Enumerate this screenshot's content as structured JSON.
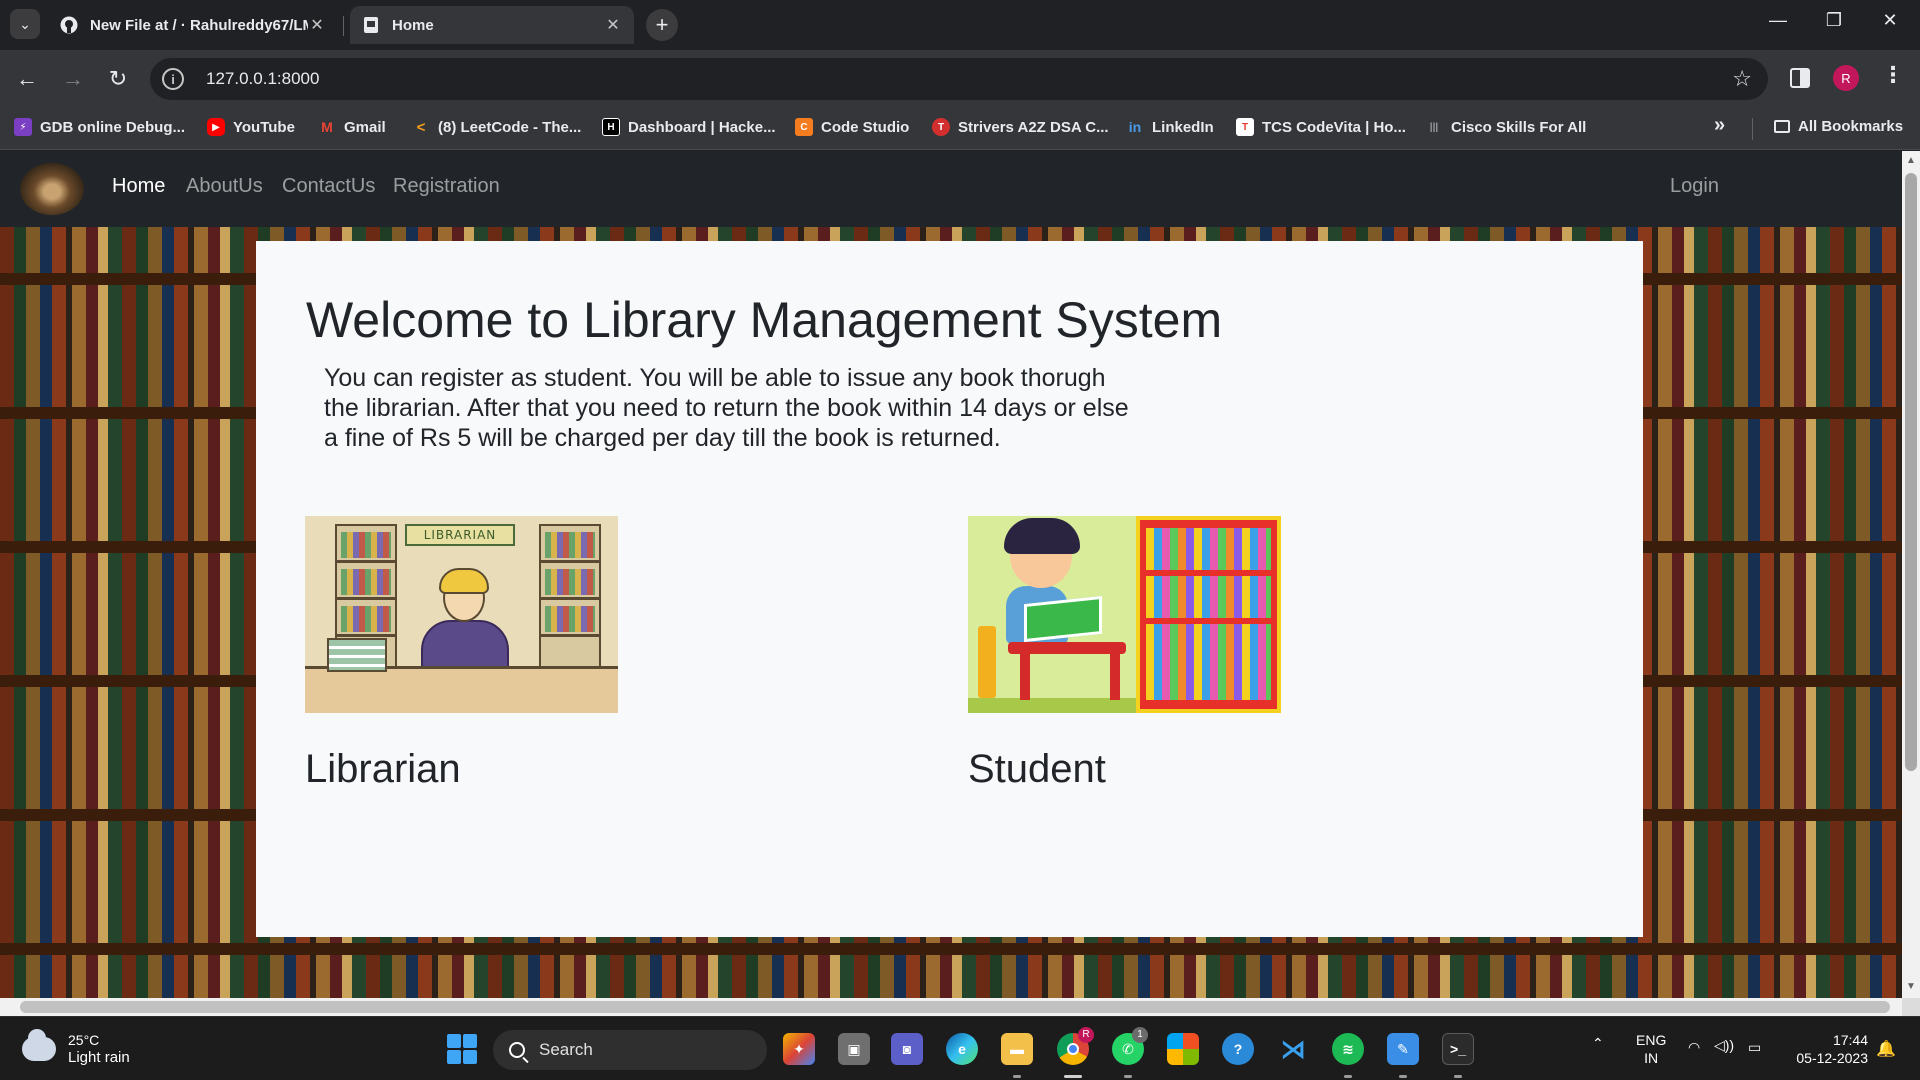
{
  "browser": {
    "tabs": [
      {
        "title": "New File at / · Rahulreddy67/LMS",
        "icon": "github-icon",
        "active": false
      },
      {
        "title": "Home",
        "icon": "page-icon",
        "active": true
      }
    ],
    "url": "127.0.0.1:8000",
    "bookmarks": [
      {
        "label": "GDB online Debug...",
        "icon": "gdb-icon",
        "color": "#7b3fc4"
      },
      {
        "label": "YouTube",
        "icon": "youtube-icon",
        "color": "#ff0000"
      },
      {
        "label": "Gmail",
        "icon": "gmail-icon",
        "color": "#ea4335"
      },
      {
        "label": "(8) LeetCode - The...",
        "icon": "leetcode-icon",
        "color": "#f89f1b"
      },
      {
        "label": "Dashboard | Hacke...",
        "icon": "hackerrank-icon",
        "color": "#1ba94c"
      },
      {
        "label": "Code Studio",
        "icon": "codestudio-icon",
        "color": "#f57c1f"
      },
      {
        "label": "Strivers A2Z DSA C...",
        "icon": "tuf-icon",
        "color": "#d32f2f"
      },
      {
        "label": "LinkedIn",
        "icon": "linkedin-icon",
        "color": "#0a66c2"
      },
      {
        "label": "TCS CodeVita | Ho...",
        "icon": "tcs-icon",
        "color": "#e53935"
      },
      {
        "label": "Cisco Skills For All",
        "icon": "cisco-icon",
        "color": "#5f6368"
      }
    ],
    "overflow_label": "»",
    "all_bookmarks": "All Bookmarks",
    "profile_initial": "R"
  },
  "navbar": {
    "links": [
      "Home",
      "AboutUs",
      "ContactUs",
      "Registration"
    ],
    "active": "Home",
    "login": "Login"
  },
  "main": {
    "heading": "Welcome to Library Management System",
    "intro": "You can register as student. You will be able to issue any book thorugh the librarian. After that you need to return the book within 14 days or else a fine of Rs 5 will be charged per day till the book is returned.",
    "roles": [
      {
        "label": "Librarian",
        "image": "librarian-illustration",
        "sign": "LIBRARIAN"
      },
      {
        "label": "Student",
        "image": "student-illustration"
      }
    ]
  },
  "taskbar": {
    "weather_temp": "25°C",
    "weather_condition": "Light rain",
    "search_placeholder": "Search",
    "language": "ENG",
    "region": "IN",
    "time": "17:44",
    "date": "05-12-2023",
    "whatsapp_badge": "1",
    "chrome_badge": "R"
  },
  "colors": {
    "navbar_bg": "#212529",
    "card_bg": "#f8f9fa",
    "text_dark": "#212529"
  }
}
